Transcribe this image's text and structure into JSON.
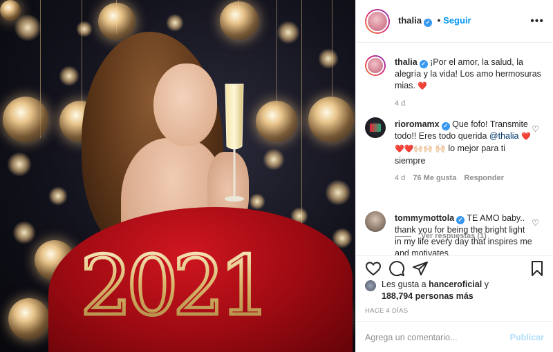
{
  "post": {
    "image_alt": "thalia",
    "year_text": "2021"
  },
  "header": {
    "username": "thalia",
    "verified": true,
    "separator": "•",
    "follow_label": "Seguir",
    "more_icon": "more-horizontal-icon"
  },
  "caption": {
    "username": "thalia",
    "text": "¡Por el amor, la salud, la alegría y la vida! Los amo hermosuras mias.",
    "emoji": "❤️",
    "age": "4 d"
  },
  "comments": [
    {
      "username": "rioromamx",
      "text_before": "Que fofo! Transmite todo!! Eres todo querida",
      "mention": "@thalia",
      "hearts": "❤️❤️❤️🙌🏻🙌🏻",
      "text_after": "🙌🏻 lo mejor para ti siempre",
      "age": "4 d",
      "likes": "76 Me gusta",
      "reply_label": "Responder",
      "view_replies": "Ver respuestas (1)"
    },
    {
      "username": "tommymottola",
      "text": "TE AMO baby.. thank you for being the bright light in my life every day that inspires me and motivates"
    }
  ],
  "likes": {
    "prefix": "Les gusta a",
    "user": "hanceroficial",
    "conjunction": "y",
    "count": "188,794 personas más"
  },
  "timestamp": "HACE 4 DÍAS",
  "comment_box": {
    "placeholder": "Agrega un comentario...",
    "publish_label": "Publicar"
  },
  "icons": {
    "like": "heart-icon",
    "comment": "comment-icon",
    "share": "paper-plane-icon",
    "save": "bookmark-icon"
  }
}
